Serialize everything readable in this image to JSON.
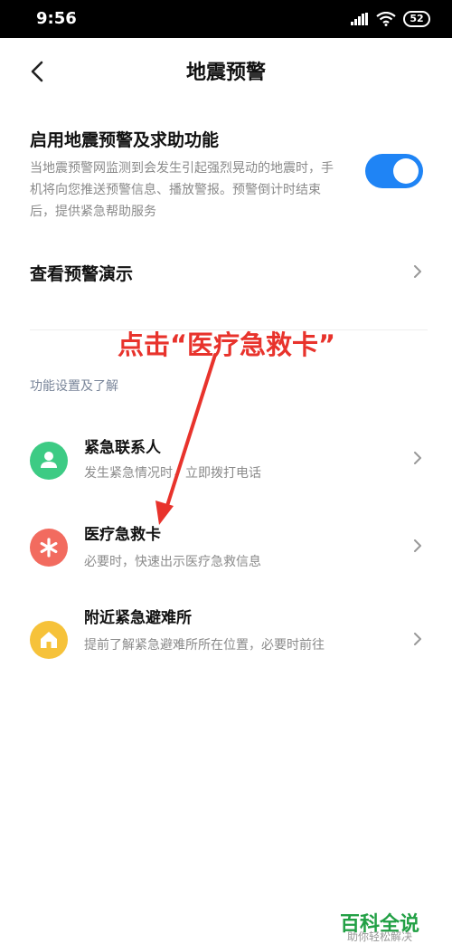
{
  "status_bar": {
    "time": "9:56",
    "battery": "52"
  },
  "header": {
    "title": "地震预警"
  },
  "enable": {
    "title": "启用地震预警及求助功能",
    "description": "当地震预警网监测到会发生引起强烈晃动的地震时，手机将向您推送预警信息、播放警报。预警倒计时结束后，提供紧急帮助服务",
    "toggle_on": true,
    "toggle_color": "#1f84f5"
  },
  "demo": {
    "label": "查看预警演示"
  },
  "section": {
    "label": "功能设置及了解"
  },
  "features": [
    {
      "title": "紧急联系人",
      "desc": "发生紧急情况时，立即拨打电话",
      "icon": "person-icon",
      "color": "#3dcb84"
    },
    {
      "title": "医疗急救卡",
      "desc": "必要时，快速出示医疗急救信息",
      "icon": "asterisk-icon",
      "color": "#f26b5f"
    },
    {
      "title": "附近紧急避难所",
      "desc": "提前了解紧急避难所所在位置，必要时前往",
      "icon": "shelter-icon",
      "color": "#f6c23a"
    }
  ],
  "annotation": {
    "text": "点击“医疗急救卡”",
    "color": "#e8332c"
  },
  "watermark": {
    "title": "百科全说",
    "subtitle": "助你轻松解决"
  }
}
